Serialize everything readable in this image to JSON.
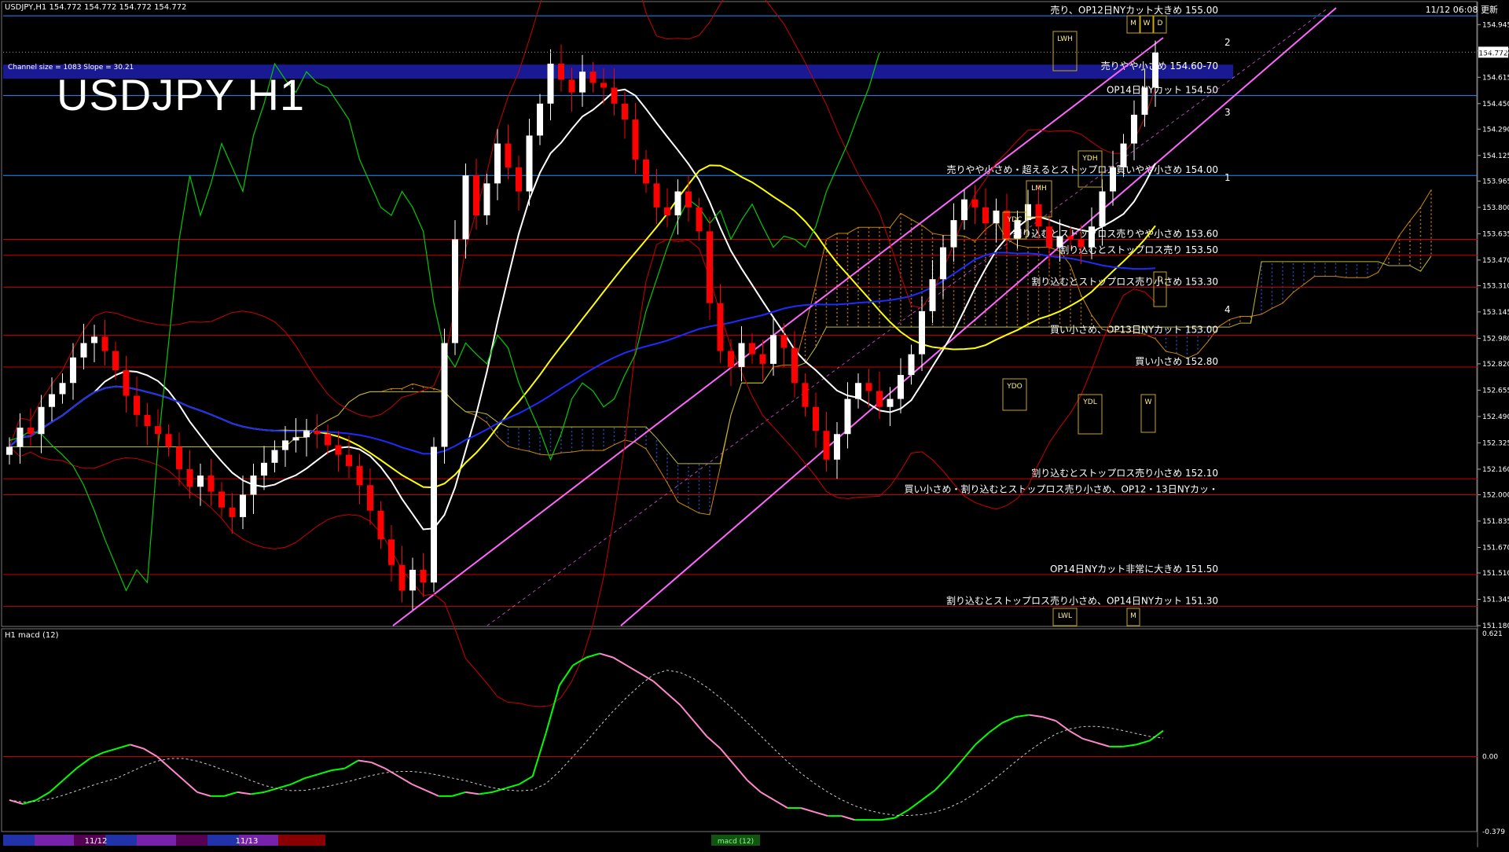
{
  "header": {
    "symbol_info": "USDJPY,H1  154.772 154.772 154.772 154.772",
    "title": "USDJPY H1",
    "channel_info": "Channel size = 1083 Slope = 30.21",
    "clock": "11/12 06:08 更新",
    "subwindow_title": "H1  macd (12)",
    "subwindow_tag": "macd (12)"
  },
  "colors": {
    "background": "#000000",
    "bull": "#ffffff",
    "bear": "#ff0000",
    "level_line": "#cc0000",
    "blue_line": "#1e90ff",
    "channel": "#ff66ff",
    "cloud_a": "#ff9933",
    "cloud_b": "#3366ff",
    "tenkan": "#ffffff",
    "kijun": "#ffff00",
    "ma_blue": "#1c2cff",
    "bollinger": "#cc0000",
    "chikou": "#00cc00",
    "macd_up": "#00ff00",
    "macd_down": "#ff88cc",
    "banner": "#1a1a99"
  },
  "chart_data": {
    "type": "candlestick",
    "symbol": "USDJPY",
    "timeframe": "H1",
    "ylim": [
      151.18,
      155.03
    ],
    "y_ticks": [
      "154.945",
      "154.780",
      "154.615",
      "154.450",
      "154.290",
      "154.125",
      "153.965",
      "153.800",
      "153.635",
      "153.470",
      "153.310",
      "153.145",
      "152.980",
      "152.820",
      "152.655",
      "152.490",
      "152.325",
      "152.160",
      "152.000",
      "151.835",
      "151.670",
      "151.510",
      "151.345",
      "151.180"
    ],
    "current_price": "154.772",
    "date_labels": [
      "11/12",
      "11/13"
    ],
    "levels": [
      {
        "price": 155.0,
        "label": "売り、OP12日NYカット大きめ 155.00",
        "color": "blue"
      },
      {
        "price": 154.65,
        "label": "売りやや小さめ 154.60-70",
        "color": "band"
      },
      {
        "price": 154.5,
        "label": "OP14日NYカット 154.50",
        "color": "blue"
      },
      {
        "price": 154.0,
        "label": "売りやや小さめ・超えるとストップロス買いやや小さめ 154.00",
        "color": "blue"
      },
      {
        "price": 153.6,
        "label": "割り込むとストップロス売りやや小さめ 153.60",
        "color": "red"
      },
      {
        "price": 153.5,
        "label": "割り込むとストップロス売り 153.50",
        "color": "red"
      },
      {
        "price": 153.3,
        "label": "割り込むとストップロス売り小さめ 153.30",
        "color": "red"
      },
      {
        "price": 153.0,
        "label": "買い小さめ、OP13日NYカット 153.00",
        "color": "red"
      },
      {
        "price": 152.8,
        "label": "買い小さめ 152.80",
        "color": "red"
      },
      {
        "price": 152.1,
        "label": "割り込むとストップロス売り小さめ 152.10",
        "color": "red"
      },
      {
        "price": 152.0,
        "label": "買い小さめ・割り込むとストップロス売り小さめ、OP12・13日NYカッ・",
        "color": "red"
      },
      {
        "price": 151.5,
        "label": "OP14日NYカット非常に大きめ 151.50",
        "color": "red"
      },
      {
        "price": 151.3,
        "label": "割り込むとストップロス売り小さめ、OP14日NYカット 151.30",
        "color": "red"
      }
    ],
    "channel_labels": [
      "1",
      "2",
      "3",
      "4"
    ],
    "box_labels": [
      "LWH",
      "YDH",
      "LMH",
      "YDC",
      "YDO",
      "YDL",
      "W",
      "D",
      "M",
      "W",
      "D",
      "LWL",
      "M"
    ],
    "close": [
      152.3,
      152.42,
      152.38,
      152.55,
      152.63,
      152.7,
      152.86,
      152.95,
      152.99,
      152.9,
      152.78,
      152.62,
      152.5,
      152.43,
      152.38,
      152.3,
      152.16,
      152.05,
      152.12,
      152.02,
      151.92,
      151.86,
      152.0,
      152.12,
      152.2,
      152.28,
      152.34,
      152.36,
      152.4,
      152.38,
      152.31,
      152.25,
      152.18,
      152.06,
      151.9,
      151.72,
      151.56,
      151.4,
      151.53,
      151.45,
      152.3,
      152.95,
      153.6,
      154.0,
      153.75,
      153.95,
      154.2,
      154.05,
      153.9,
      154.25,
      154.45,
      154.7,
      154.6,
      154.52,
      154.65,
      154.58,
      154.55,
      154.45,
      154.35,
      154.1,
      153.95,
      153.8,
      153.75,
      153.9,
      153.8,
      153.65,
      153.2,
      152.9,
      152.8,
      152.95,
      152.88,
      152.82,
      153.0,
      152.92,
      152.7,
      152.55,
      152.4,
      152.22,
      152.38,
      152.6,
      152.7,
      152.65,
      152.55,
      152.6,
      152.75,
      152.88,
      153.15,
      153.35,
      153.55,
      153.72,
      153.85,
      153.8,
      153.7,
      153.78,
      153.6,
      153.72,
      153.82,
      153.68,
      153.55,
      153.62,
      153.6,
      153.55,
      153.68,
      153.9,
      154.05,
      154.2,
      154.38,
      154.55,
      154.77
    ],
    "ichimoku": {
      "span_a_color": "orange",
      "span_b_color": "blue"
    },
    "macd": {
      "ylim": [
        -0.379,
        0.621
      ],
      "y_ticks": [
        "0.621",
        "0.00",
        "-0.379"
      ],
      "main": [
        -0.22,
        -0.24,
        -0.22,
        -0.18,
        -0.12,
        -0.06,
        -0.01,
        0.02,
        0.04,
        0.06,
        0.04,
        0.0,
        -0.06,
        -0.12,
        -0.18,
        -0.2,
        -0.2,
        -0.18,
        -0.19,
        -0.18,
        -0.16,
        -0.14,
        -0.11,
        -0.09,
        -0.07,
        -0.06,
        -0.02,
        -0.03,
        -0.06,
        -0.1,
        -0.14,
        -0.17,
        -0.2,
        -0.2,
        -0.18,
        -0.19,
        -0.18,
        -0.16,
        -0.14,
        -0.1,
        0.12,
        0.36,
        0.46,
        0.5,
        0.52,
        0.5,
        0.46,
        0.42,
        0.38,
        0.32,
        0.26,
        0.18,
        0.1,
        0.04,
        -0.04,
        -0.12,
        -0.18,
        -0.22,
        -0.26,
        -0.26,
        -0.28,
        -0.3,
        -0.3,
        -0.32,
        -0.32,
        -0.32,
        -0.31,
        -0.27,
        -0.22,
        -0.17,
        -0.1,
        -0.02,
        0.06,
        0.12,
        0.17,
        0.2,
        0.21,
        0.2,
        0.18,
        0.13,
        0.09,
        0.07,
        0.05,
        0.05,
        0.06,
        0.08,
        0.13
      ]
    }
  }
}
